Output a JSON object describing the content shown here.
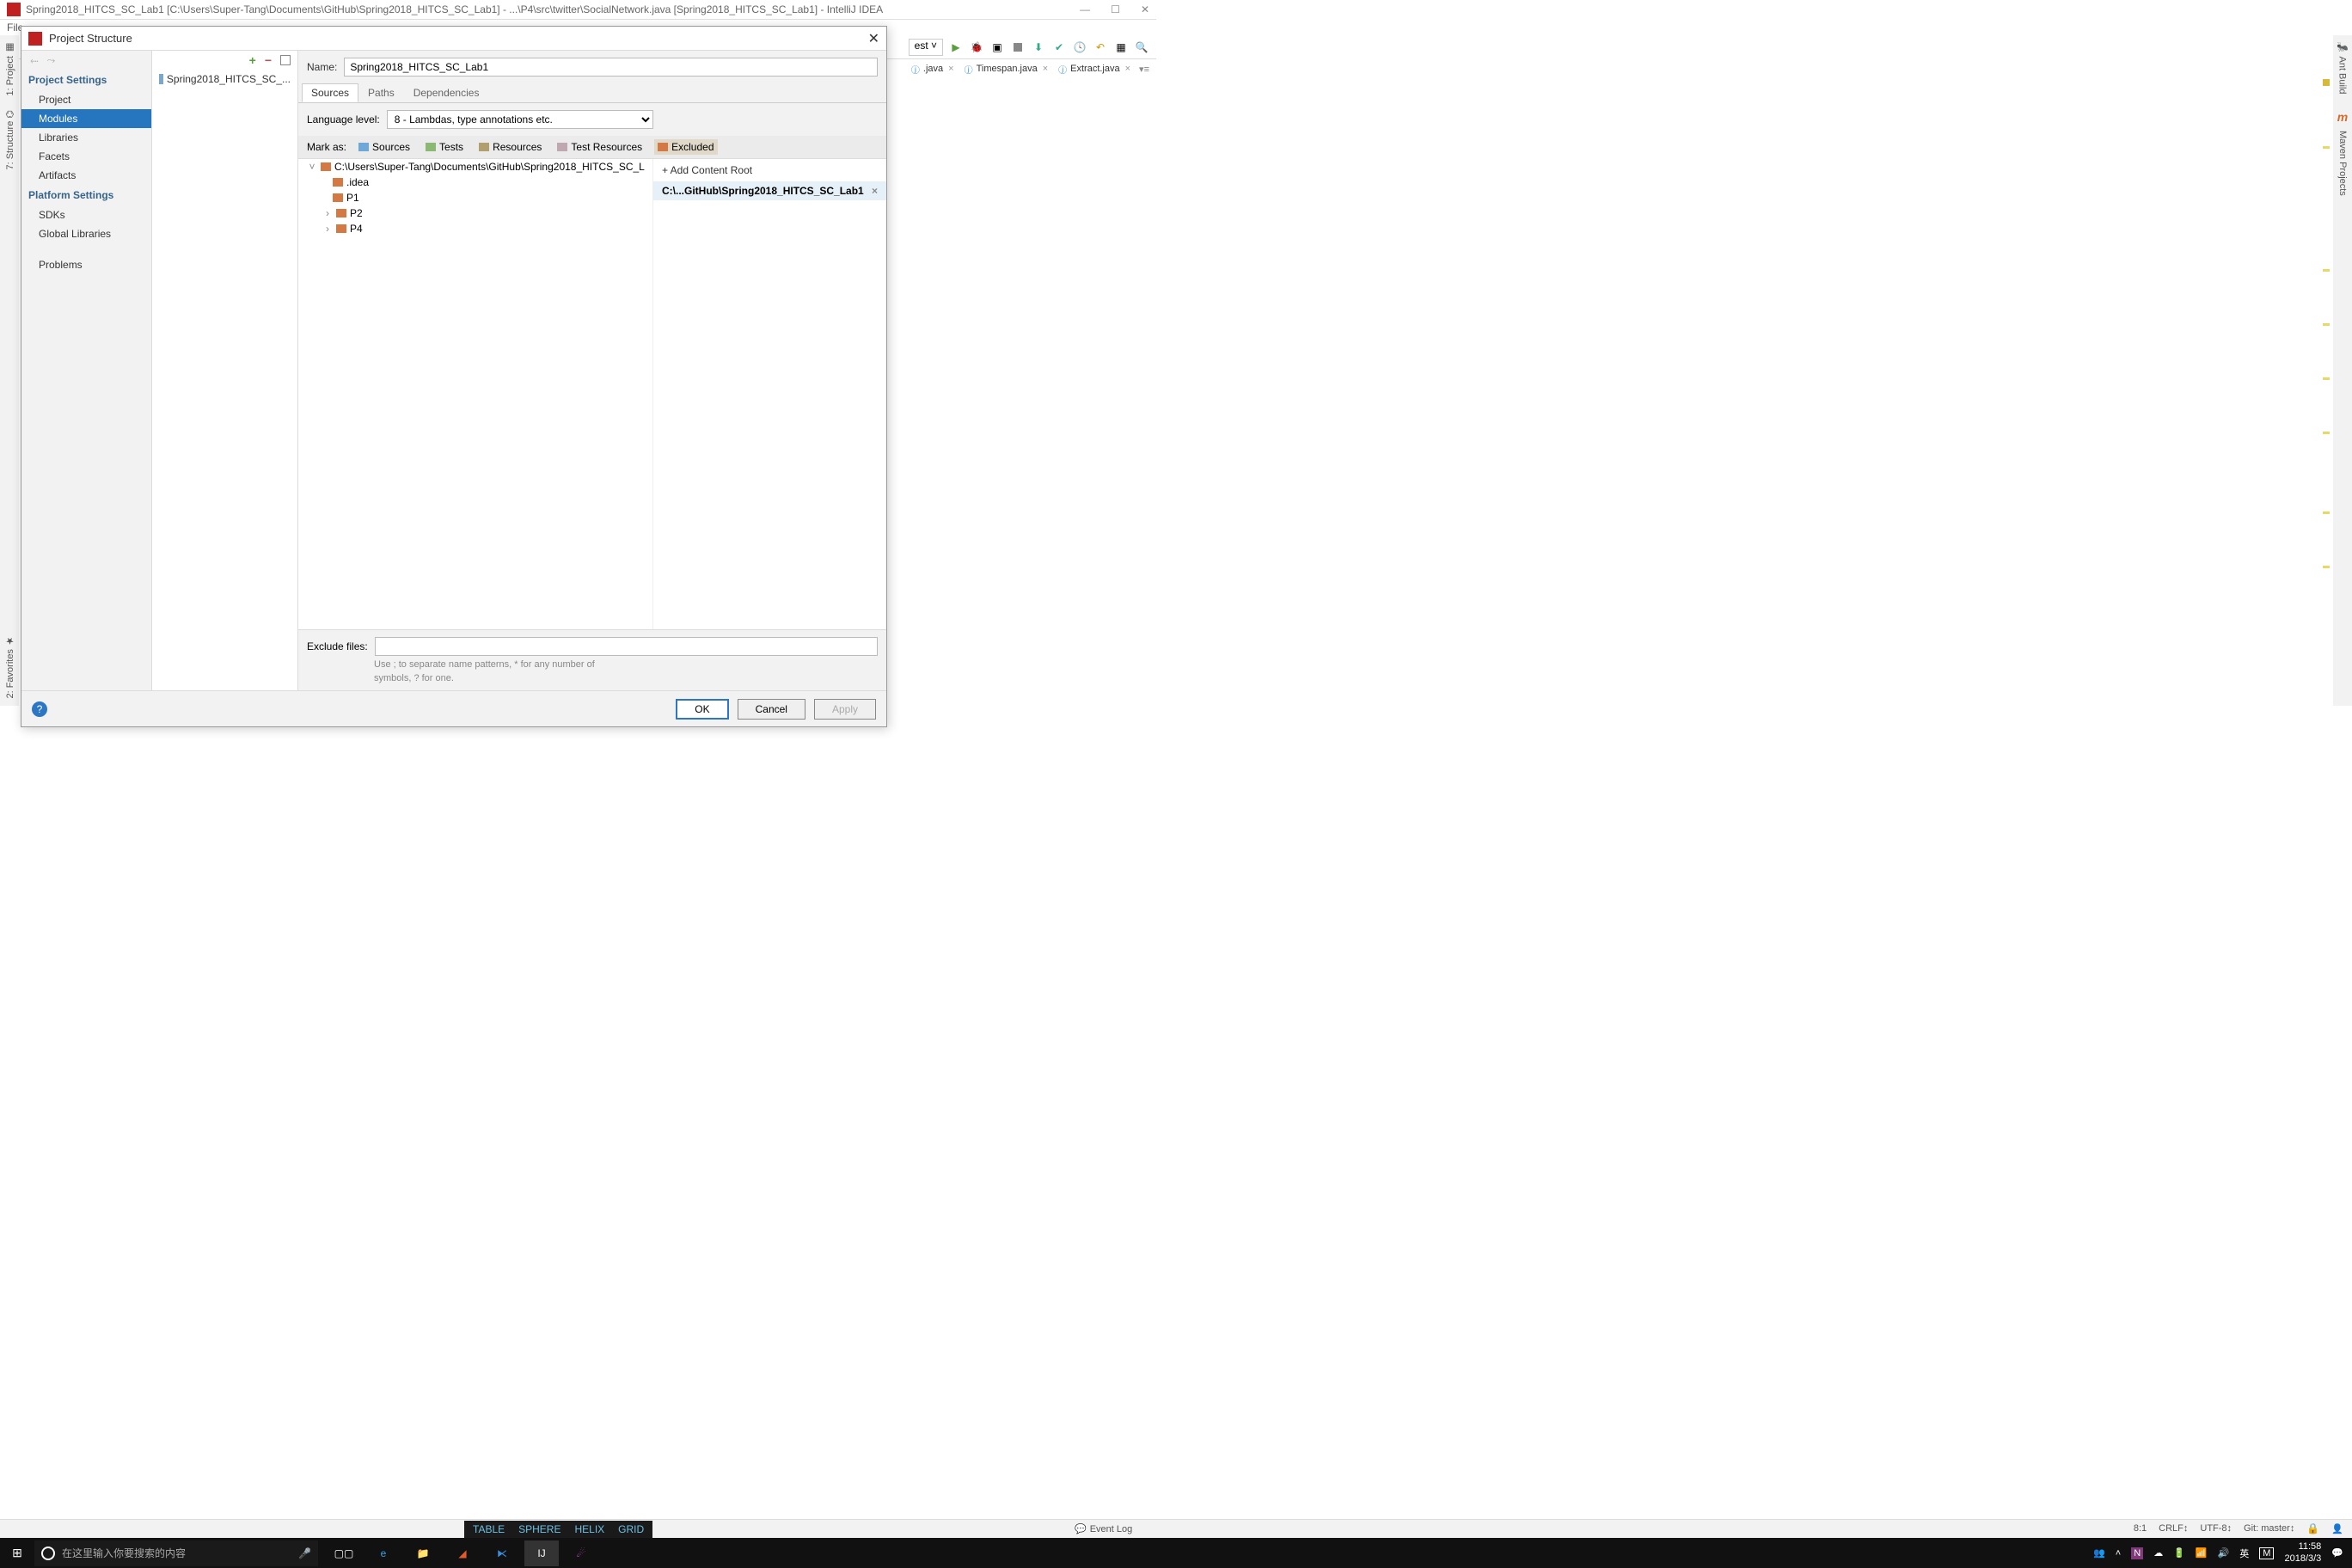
{
  "window": {
    "title": "Spring2018_HITCS_SC_Lab1 [C:\\Users\\Super-Tang\\Documents\\GitHub\\Spring2018_HITCS_SC_Lab1] - ...\\P4\\src\\twitter\\SocialNetwork.java [Spring2018_HITCS_SC_Lab1] - IntelliJ IDEA",
    "menu_file": "File"
  },
  "toolbar": {
    "config_suffix": "est"
  },
  "editor_tabs": {
    "t1": ".java",
    "t2": "Timespan.java",
    "t3": "Extract.java"
  },
  "left_tabs": {
    "project": "1: Project",
    "structure": "7: Structure",
    "favorites": "2: Favorites"
  },
  "right_tabs": {
    "ant": "Ant Build",
    "maven": "Maven Projects"
  },
  "dialog": {
    "title": "Project Structure",
    "nav": {
      "head1": "Project Settings",
      "project": "Project",
      "modules": "Modules",
      "libraries": "Libraries",
      "facets": "Facets",
      "artifacts": "Artifacts",
      "head2": "Platform Settings",
      "sdks": "SDKs",
      "global": "Global Libraries",
      "problems": "Problems"
    },
    "module_item": "Spring2018_HITCS_SC_...",
    "name_label": "Name:",
    "name_value": "Spring2018_HITCS_SC_Lab1",
    "tabs": {
      "sources": "Sources",
      "paths": "Paths",
      "deps": "Dependencies"
    },
    "lang_label": "Language level:",
    "lang_value": "8 - Lambdas, type annotations etc.",
    "mark_label": "Mark as:",
    "mark": {
      "sources": "Sources",
      "tests": "Tests",
      "resources": "Resources",
      "tres": "Test Resources",
      "excluded": "Excluded"
    },
    "tree": {
      "root": "C:\\Users\\Super-Tang\\Documents\\GitHub\\Spring2018_HITCS_SC_L",
      "idea": ".idea",
      "p1": "P1",
      "p2": "P2",
      "p4": "P4"
    },
    "roots": {
      "add": "+ Add Content Root",
      "item": "C:\\...GitHub\\Spring2018_HITCS_SC_Lab1"
    },
    "exclude_label": "Exclude files:",
    "exclude_hint1": "Use ; to separate name patterns, * for any number of",
    "exclude_hint2": "symbols, ? for one.",
    "buttons": {
      "ok": "OK",
      "cancel": "Cancel",
      "apply": "Apply"
    }
  },
  "status": {
    "event_log": "Event Log",
    "pos": "8:1",
    "crlf": "CRLF",
    "enc": "UTF-8",
    "git": "Git: master"
  },
  "taskbar": {
    "search_placeholder": "在这里输入你要搜索的内容",
    "ime": "英",
    "ime2": "M",
    "time": "11:58",
    "date": "2018/3/3",
    "float": {
      "a": "TABLE",
      "b": "SPHERE",
      "c": "HELIX",
      "d": "GRID"
    }
  }
}
